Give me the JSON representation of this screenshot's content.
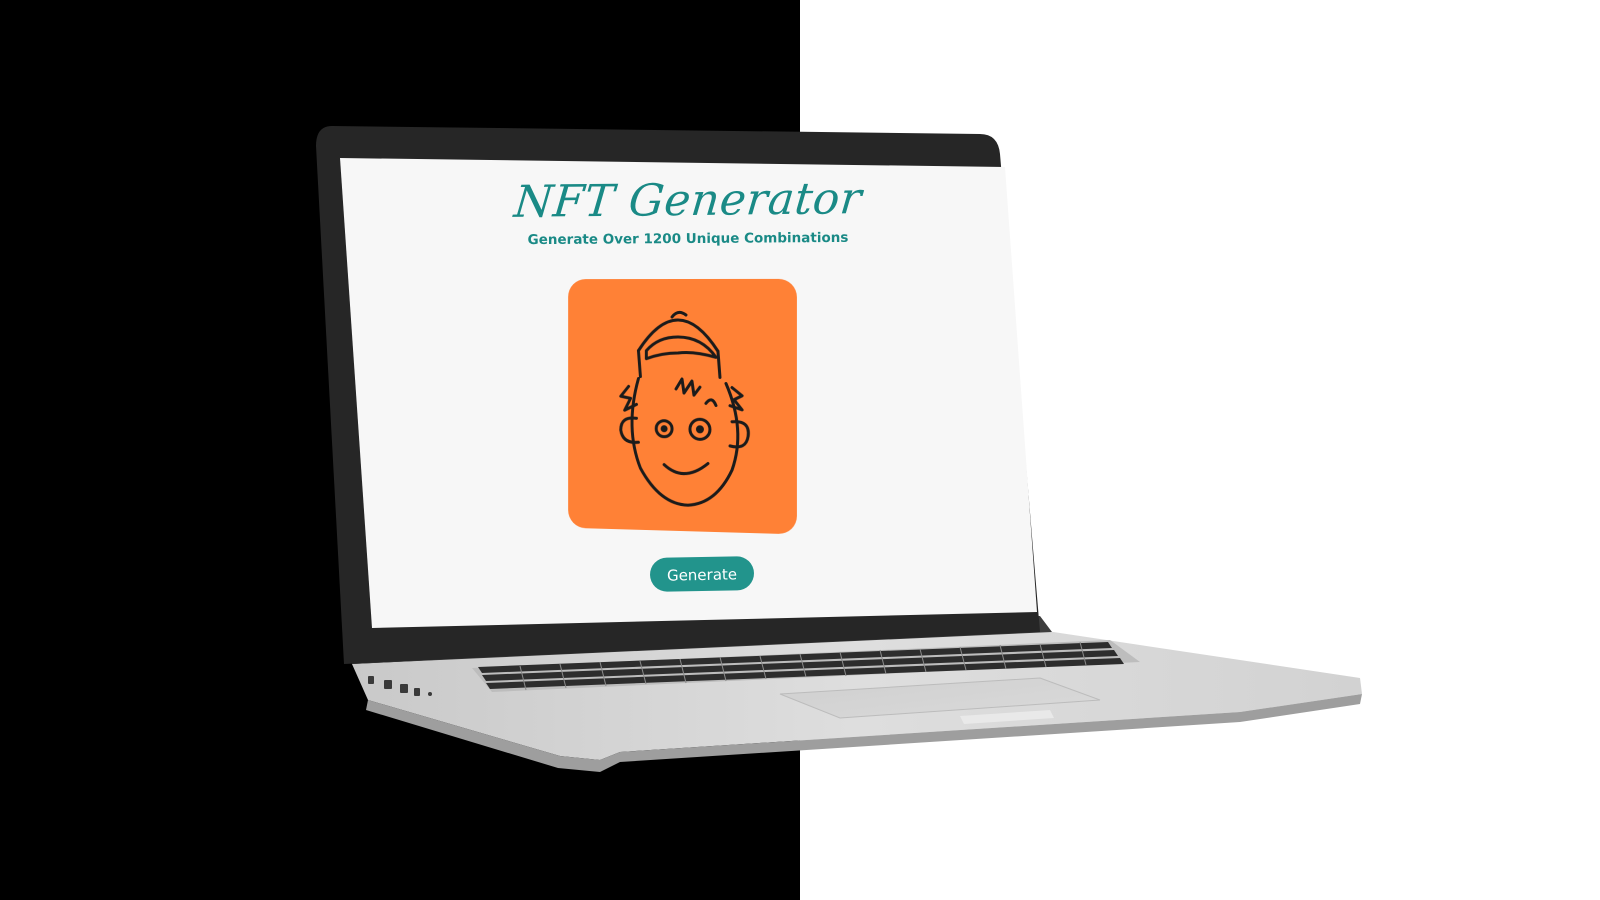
{
  "app": {
    "title": "NFT Generator",
    "subtitle": "Generate Over 1200 Unique Combinations"
  },
  "preview": {
    "background_color": "#ff8136",
    "icon": "cartoon-face-with-cap"
  },
  "actions": {
    "generate_label": "Generate"
  },
  "colors": {
    "accent": "#1a8a86",
    "button": "#22948c",
    "screen_bg": "#f7f7f7"
  }
}
